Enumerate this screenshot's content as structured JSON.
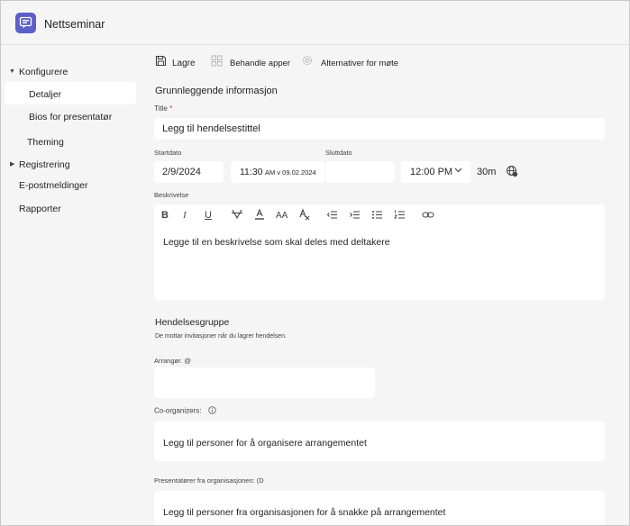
{
  "app": {
    "title": "Nettseminar"
  },
  "sidebar": {
    "items": [
      {
        "label": "Konfigurere"
      },
      {
        "label": "Detaljer"
      },
      {
        "label": "Bios for presentatør"
      },
      {
        "label": "Theming"
      },
      {
        "label": "Registrering"
      },
      {
        "label": "E-postmeldinger"
      },
      {
        "label": "Rapporter"
      }
    ]
  },
  "toolbar": {
    "save_label": "Lagre",
    "manage_apps_label": "Behandle apper",
    "meeting_options_label": "Alternativer for møte"
  },
  "basic_info": {
    "section_title": "Grunnleggende informasjon",
    "title_label": "Title",
    "title_required_mark": "*",
    "title_placeholder": "Legg til hendelsestittel",
    "start_date_label": "Startdato",
    "start_date_value": "2/9/2024",
    "start_time_value": "11:30",
    "start_time_suffix": "AM v 09.02.2024",
    "end_date_label": "Sluttdato",
    "end_date_value": "",
    "end_time_value": "12:00 PM",
    "duration": "30m",
    "description_label": "Beskrivelse",
    "description_placeholder": "Legge til en beskrivelse som skal deles med deltakere"
  },
  "event_group": {
    "section_title": "Hendelsesgruppe",
    "helper": "De mottar invitasjoner når du lagrer hendelsen.",
    "organizer_label": "Arrangør. @",
    "co_organizers_label": "Co-organizers:",
    "co_organizers_placeholder": "Legg til personer for å organisere arrangementet",
    "presenters_label": "Presentatører  fra organisasjonen: (D",
    "presenters_placeholder": "Legg til personer fra organisasjonen for å snakke på arrangementet"
  },
  "colors": {
    "accent": "#5b5fc7",
    "background": "#f5f5f5",
    "card": "#ffffff",
    "required": "#c4314b"
  }
}
